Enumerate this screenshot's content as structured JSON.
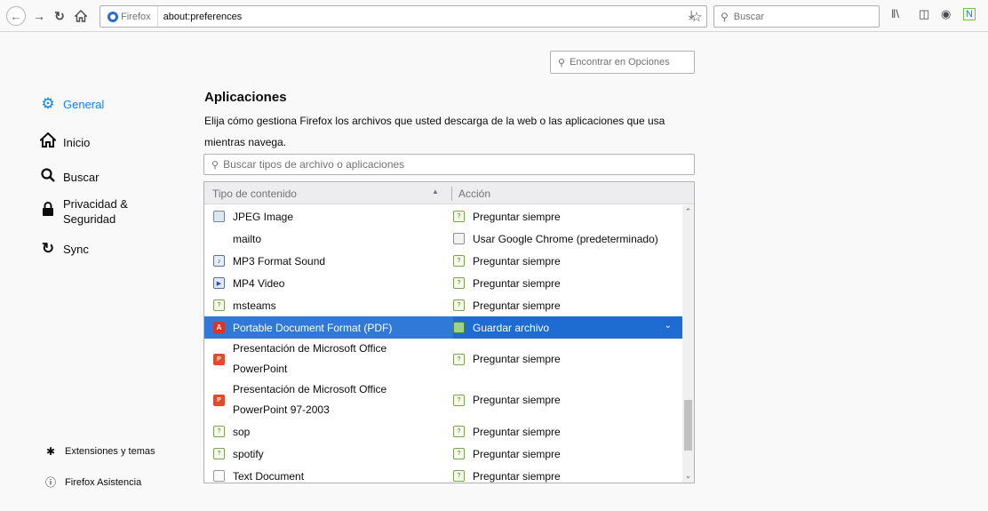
{
  "toolbar": {
    "identity_label": "Firefox",
    "url": "about:preferences",
    "search_placeholder": "Buscar"
  },
  "sidebar": {
    "items": [
      {
        "label": "General",
        "icon": "gear-icon",
        "selected": true
      },
      {
        "label": "Inicio",
        "icon": "home-icon"
      },
      {
        "label": "Buscar",
        "icon": "search-icon"
      },
      {
        "label": "Privacidad & Seguridad",
        "line1": "Privacidad &",
        "line2": "Seguridad",
        "icon": "lock-icon"
      },
      {
        "label": "Sync",
        "icon": "sync-icon"
      }
    ],
    "footer": [
      {
        "label": "Extensiones y temas",
        "icon": "puzzle-icon"
      },
      {
        "label": "Firefox Asistencia",
        "icon": "help-icon"
      }
    ]
  },
  "main": {
    "find_placeholder": "Encontrar en Opciones",
    "section_title": "Aplicaciones",
    "section_desc": "Elija cómo gestiona Firefox los archivos que usted descarga de la web o las aplicaciones que usa mientras navega.",
    "type_search_placeholder": "Buscar tipos de archivo o aplicaciones",
    "table": {
      "col_type": "Tipo de contenido",
      "col_action": "Acción",
      "rows": [
        {
          "type": "JPEG Image",
          "type_icon": "jpeg-file-icon",
          "action": "Preguntar siempre",
          "action_icon": "ask-icon"
        },
        {
          "type": "mailto",
          "type_icon": "",
          "action": "Usar Google Chrome (predeterminado)",
          "action_icon": "app-icon"
        },
        {
          "type": "MP3 Format Sound",
          "type_icon": "mp3-file-icon",
          "action": "Preguntar siempre",
          "action_icon": "ask-icon"
        },
        {
          "type": "MP4 Video",
          "type_icon": "mp4-file-icon",
          "action": "Preguntar siempre",
          "action_icon": "ask-icon"
        },
        {
          "type": "msteams",
          "type_icon": "ask-icon",
          "action": "Preguntar siempre",
          "action_icon": "ask-icon"
        },
        {
          "type": "Portable Document Format (PDF)",
          "type_icon": "pdf-file-icon",
          "action": "Guardar archivo",
          "action_icon": "save-icon",
          "selected": true
        },
        {
          "type_line1": "Presentación de Microsoft Office",
          "type_line2": "PowerPoint",
          "type_icon": "ppt-file-icon",
          "action": "Preguntar siempre",
          "action_icon": "ask-icon"
        },
        {
          "type_line1": "Presentación de Microsoft Office",
          "type_line2": "PowerPoint 97-2003",
          "type_icon": "ppt-file-icon",
          "action": "Preguntar siempre",
          "action_icon": "ask-icon"
        },
        {
          "type": "sop",
          "type_icon": "ask-icon",
          "action": "Preguntar siempre",
          "action_icon": "ask-icon"
        },
        {
          "type": "spotify",
          "type_icon": "ask-icon",
          "action": "Preguntar siempre",
          "action_icon": "ask-icon"
        },
        {
          "type": "Text Document",
          "type_icon": "text-file-icon",
          "action": "Preguntar siempre",
          "action_icon": "ask-icon"
        }
      ]
    }
  },
  "colors": {
    "accent": "#0a84ff",
    "selected_row": "#3179d9"
  }
}
